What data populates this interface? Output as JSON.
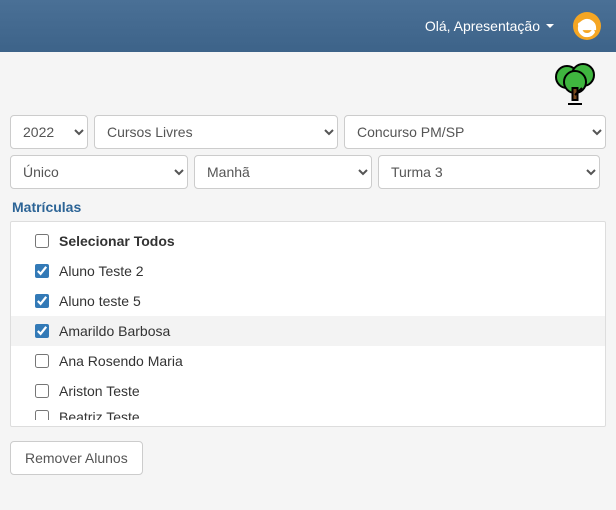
{
  "header": {
    "greeting": "Olá, Apresentação"
  },
  "filters": {
    "year": "2022",
    "course": "Cursos Livres",
    "target": "Concurso PM/SP",
    "unit": "Único",
    "shift": "Manhã",
    "class": "Turma 3"
  },
  "section": {
    "title": "Matrículas"
  },
  "list": {
    "select_all_label": "Selecionar Todos",
    "items": [
      {
        "label": "Aluno Teste 2",
        "checked": true,
        "hovered": false
      },
      {
        "label": "Aluno teste 5",
        "checked": true,
        "hovered": false
      },
      {
        "label": "Amarildo Barbosa",
        "checked": true,
        "hovered": true
      },
      {
        "label": "Ana Rosendo Maria",
        "checked": false,
        "hovered": false
      },
      {
        "label": "Ariston Teste",
        "checked": false,
        "hovered": false
      },
      {
        "label": "Beatriz Teste",
        "checked": false,
        "hovered": false
      }
    ]
  },
  "buttons": {
    "remove": "Remover Alunos"
  }
}
